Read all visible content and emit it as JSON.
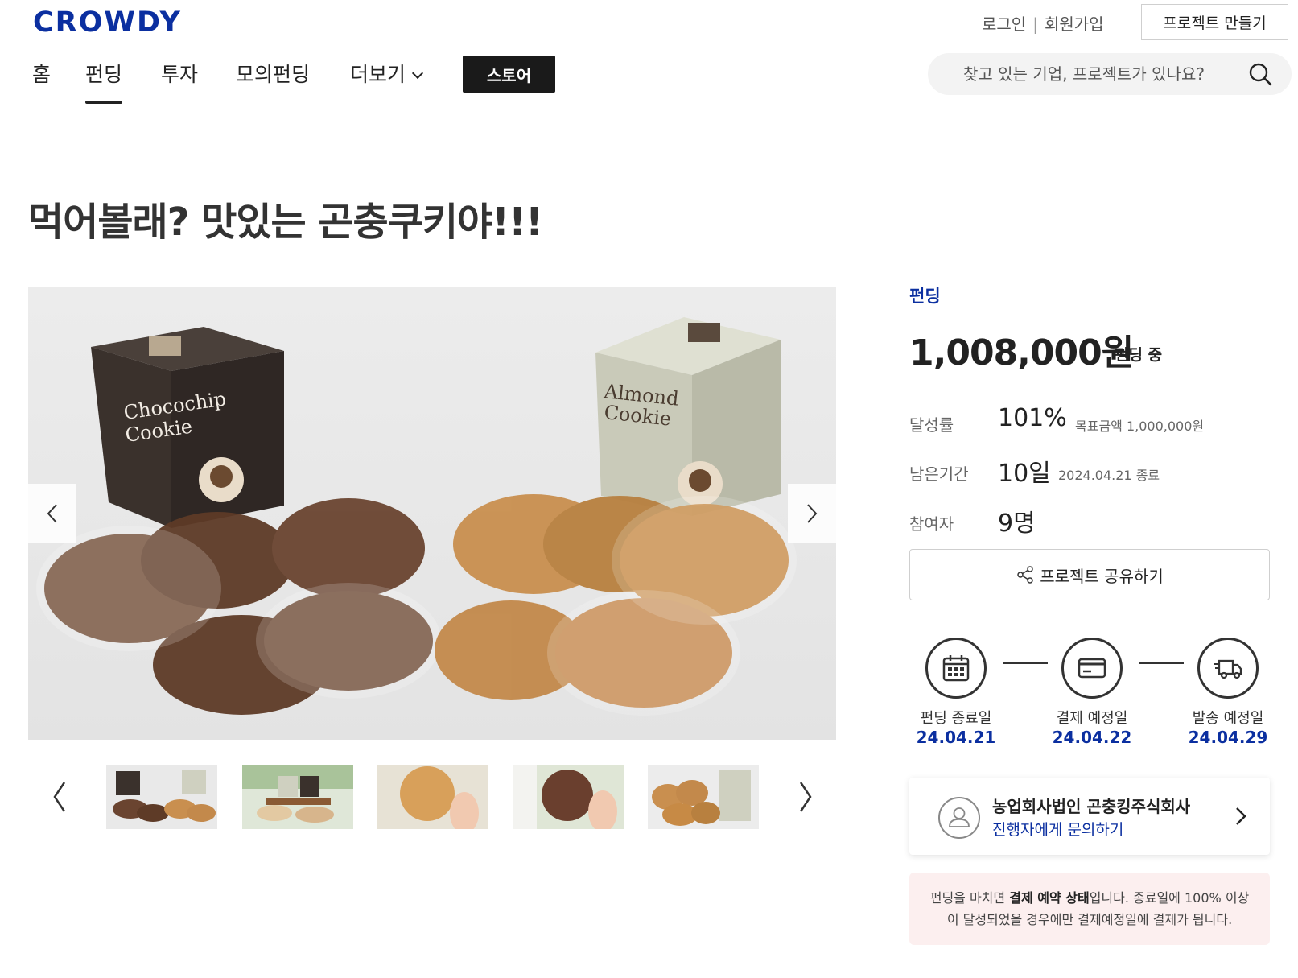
{
  "header": {
    "logo": "CROWDY",
    "login": "로그인",
    "signup": "회원가입",
    "make_project": "프로젝트 만들기",
    "nav": [
      {
        "label": "홈"
      },
      {
        "label": "펀딩"
      },
      {
        "label": "투자"
      },
      {
        "label": "모의펀딩"
      },
      {
        "label": "더보기"
      }
    ],
    "store": "스토어",
    "search_placeholder": "찾고 있는 기업, 프로젝트가 있나요?"
  },
  "project": {
    "title": "먹어볼래? 맛있는 곤충쿠키야!!!",
    "kind": "펀딩",
    "amount": "1,008,000원",
    "amount_status": "펀딩 중",
    "rate_label": "달성률",
    "rate_value": "101%",
    "goal_text": "목표금액 1,000,000원",
    "remaining_label": "남은기간",
    "remaining_value": "10일",
    "end_text": "2024.04.21 종료",
    "participants_label": "참여자",
    "participants_value": "9명",
    "share": "프로젝트 공유하기"
  },
  "image": {
    "box_left_line1": "Chocochip",
    "box_left_line2": "Cookie",
    "box_right_line1": "Almond",
    "box_right_line2": "Cookie"
  },
  "steps": [
    {
      "label": "펀딩 종료일",
      "date": "24.04.21",
      "icon": "calendar-icon"
    },
    {
      "label": "결제 예정일",
      "date": "24.04.22",
      "icon": "card-icon"
    },
    {
      "label": "발송 예정일",
      "date": "24.04.29",
      "icon": "truck-icon"
    }
  ],
  "maker": {
    "name": "농업회사법인 곤충킹주식회사",
    "contact": "진행자에게 문의하기"
  },
  "notice": {
    "part1": "펀딩을 마치면 ",
    "bold": "결제 예약 상태",
    "part2": "입니다. 종료일에 100% 이상이 달성되었을 경우에만 결제예정일에 결제가 됩니다."
  },
  "colors": {
    "brand": "#0b2fa0",
    "notice_bg": "#fcefef"
  }
}
